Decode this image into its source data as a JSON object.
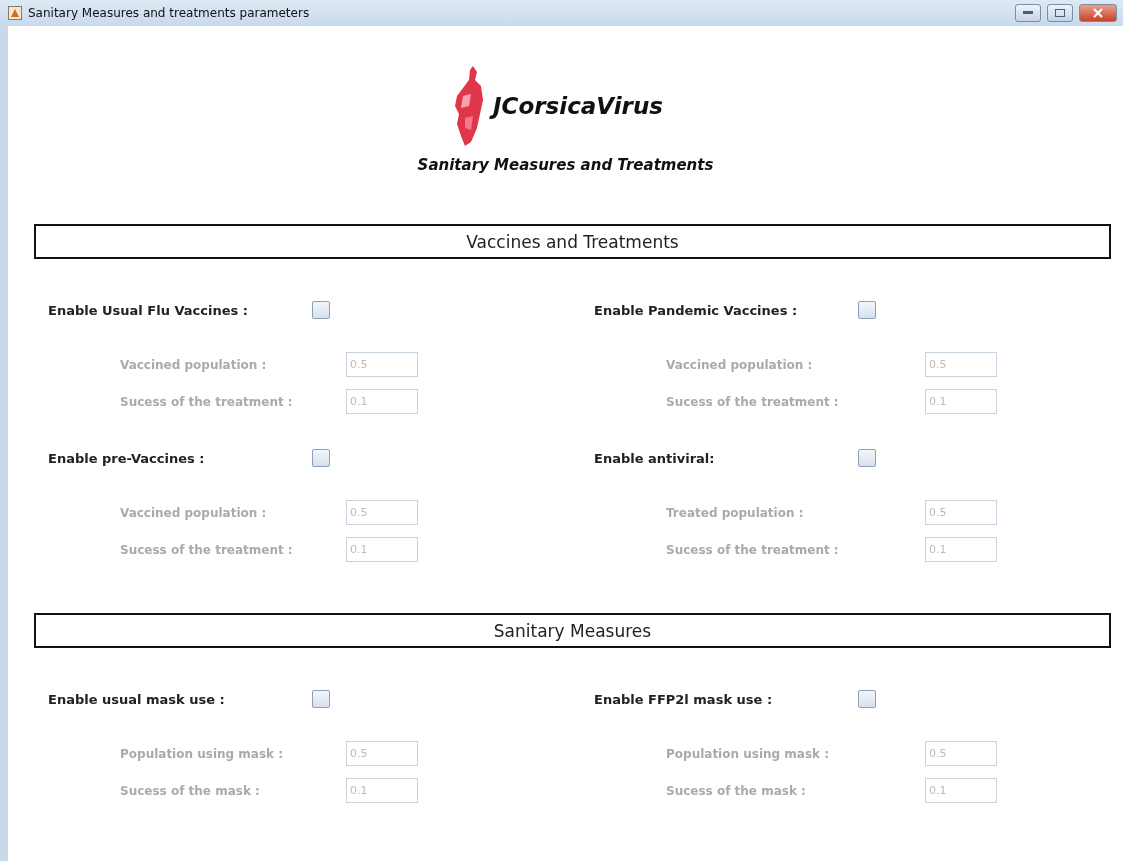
{
  "window": {
    "title": "Sanitary Measures and treatments parameters"
  },
  "header": {
    "logo_text": "JCorsicaVirus",
    "subtitle": "Sanitary Measures and Treatments"
  },
  "sections": [
    {
      "title": "Vaccines and Treatments",
      "groups": [
        {
          "label": "Enable Usual Flu Vaccines :",
          "checked": false,
          "fields": [
            {
              "label": "Vaccined population :",
              "value": "0.5",
              "disabled": true
            },
            {
              "label": "Sucess of the treatment :",
              "value": "0.1",
              "disabled": true
            }
          ]
        },
        {
          "label": "Enable Pandemic Vaccines :",
          "checked": false,
          "fields": [
            {
              "label": "Vaccined population :",
              "value": "0.5",
              "disabled": true
            },
            {
              "label": "Sucess of the treatment :",
              "value": "0.1",
              "disabled": true
            }
          ]
        },
        {
          "label": "Enable pre-Vaccines :",
          "checked": false,
          "fields": [
            {
              "label": "Vaccined population :",
              "value": "0.5",
              "disabled": true
            },
            {
              "label": "Sucess of the treatment :",
              "value": "0.1",
              "disabled": true
            }
          ]
        },
        {
          "label": "Enable antiviral:",
          "checked": false,
          "fields": [
            {
              "label": "Treated population :",
              "value": "0.5",
              "disabled": true
            },
            {
              "label": "Sucess of the treatment :",
              "value": "0.1",
              "disabled": true
            }
          ]
        }
      ]
    },
    {
      "title": "Sanitary Measures",
      "groups": [
        {
          "label": "Enable usual mask use :",
          "checked": false,
          "fields": [
            {
              "label": "Population using mask :",
              "value": "0.5",
              "disabled": true
            },
            {
              "label": "Sucess of the mask :",
              "value": "0.1",
              "disabled": true
            }
          ]
        },
        {
          "label": "Enable FFP2l mask use :",
          "checked": false,
          "fields": [
            {
              "label": "Population using mask :",
              "value": "0.5",
              "disabled": true
            },
            {
              "label": "Sucess of the mask :",
              "value": "0.1",
              "disabled": true
            }
          ]
        }
      ]
    }
  ]
}
